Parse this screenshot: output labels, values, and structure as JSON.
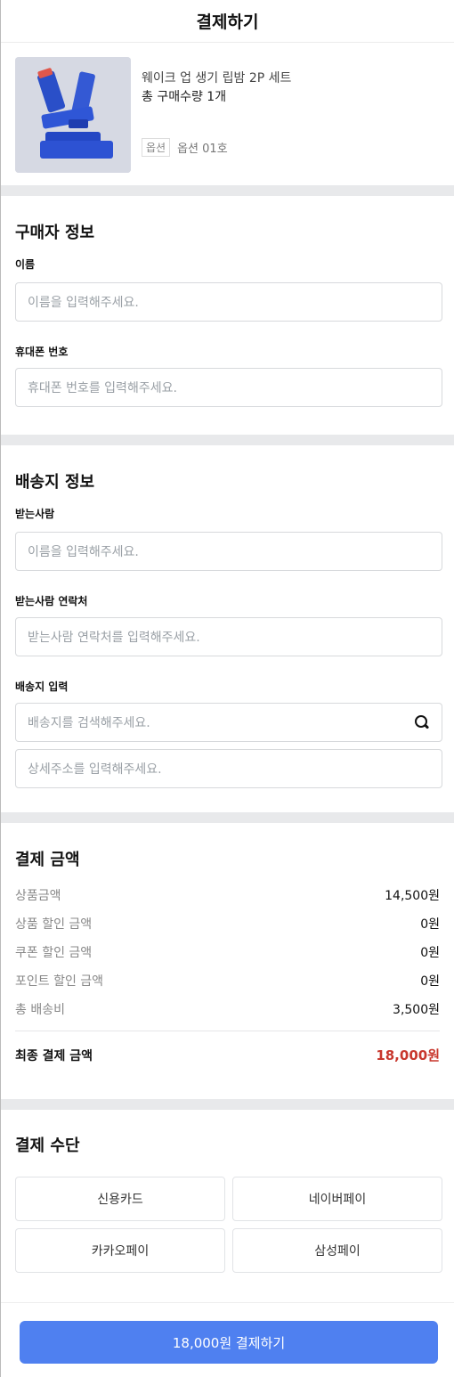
{
  "header": {
    "title": "결제하기"
  },
  "product": {
    "image_icon": "lipbalm-product-image",
    "name": "웨이크 업 생기 립밤 2P 세트",
    "quantity": "총 구매수량 1개",
    "option_tag": "옵션",
    "option_value": "옵션 01호"
  },
  "buyer": {
    "title": "구매자 정보",
    "name_label": "이름",
    "name_placeholder": "이름을 입력해주세요.",
    "phone_label": "휴대폰 번호",
    "phone_placeholder": "휴대폰 번호를 입력해주세요."
  },
  "shipping": {
    "title": "배송지 정보",
    "recipient_label": "받는사람",
    "recipient_placeholder": "이름을 입력해주세요.",
    "contact_label": "받는사람 연락처",
    "contact_placeholder": "받는사람 연락처를 입력해주세요.",
    "address_label": "배송지 입력",
    "address_placeholder": "배송지를 검색해주세요.",
    "detail_placeholder": "상세주소를 입력해주세요."
  },
  "payment_amount": {
    "title": "결제 금액",
    "rows": [
      {
        "label": "상품금액",
        "value": "14,500원"
      },
      {
        "label": "상품 할인 금액",
        "value": "0원"
      },
      {
        "label": "쿠폰 할인 금액",
        "value": "0원"
      },
      {
        "label": "포인트 할인 금액",
        "value": "0원"
      },
      {
        "label": "총 배송비",
        "value": "3,500원"
      }
    ],
    "total_label": "최종 결제 금액",
    "total_value": "18,000원"
  },
  "payment_method": {
    "title": "결제 수단",
    "options": [
      "신용카드",
      "네이버페이",
      "카카오페이",
      "삼성페이"
    ]
  },
  "submit": {
    "label": "18,000원 결제하기"
  },
  "colors": {
    "accent": "#4f80f0",
    "total": "#c8372d",
    "divider": "#e8e9eb"
  }
}
